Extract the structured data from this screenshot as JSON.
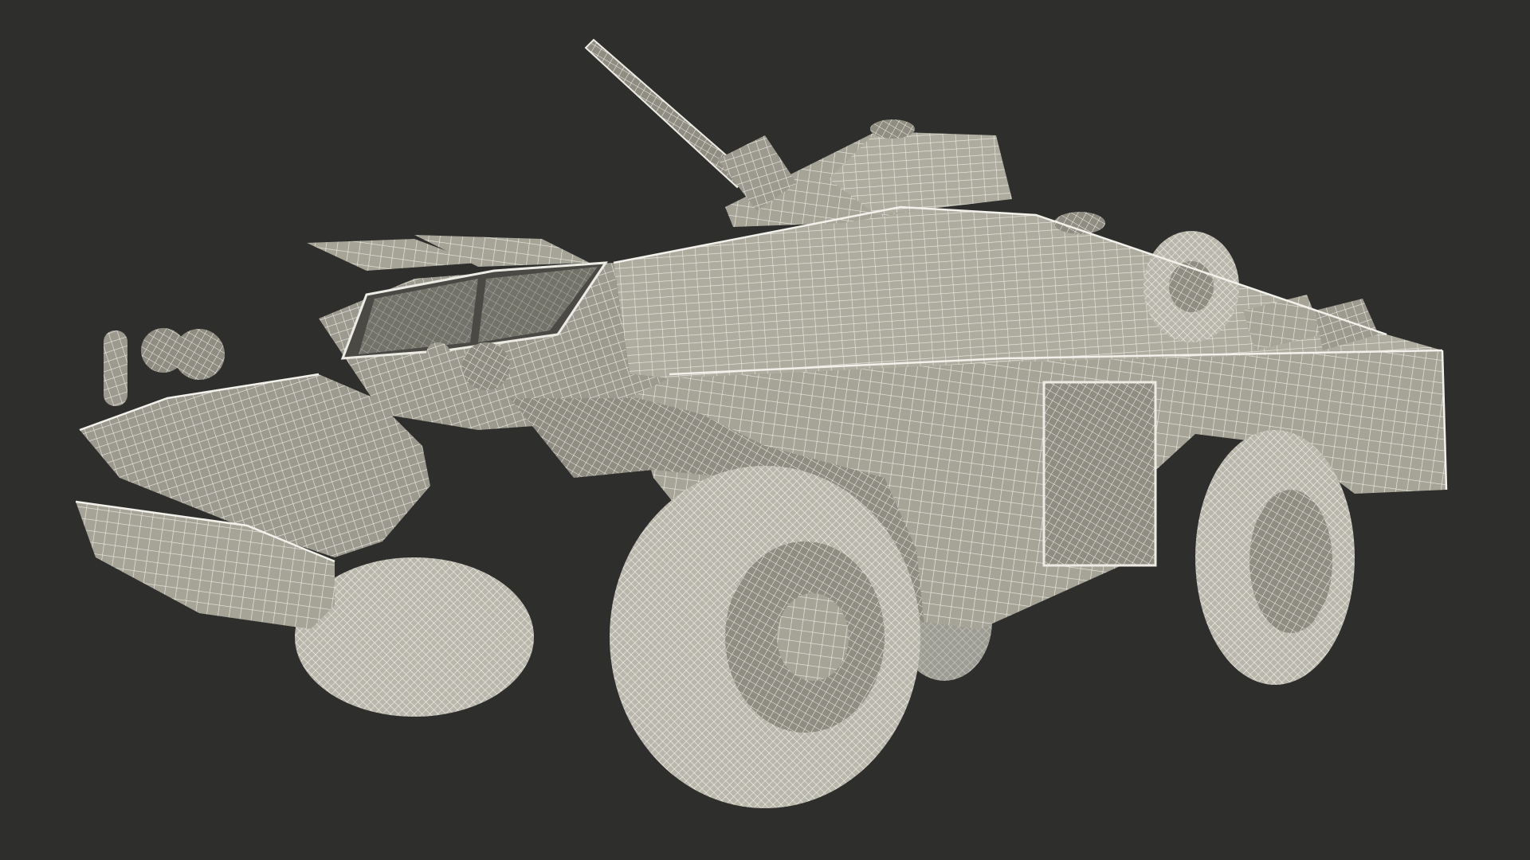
{
  "scene": {
    "background_color": "#2e2e2d",
    "model_surface_color": "#a6a497",
    "model_shade_color": "#7b796f",
    "wire_color": "#ecebe4",
    "subject": "armored-scout-car-wireframe"
  }
}
